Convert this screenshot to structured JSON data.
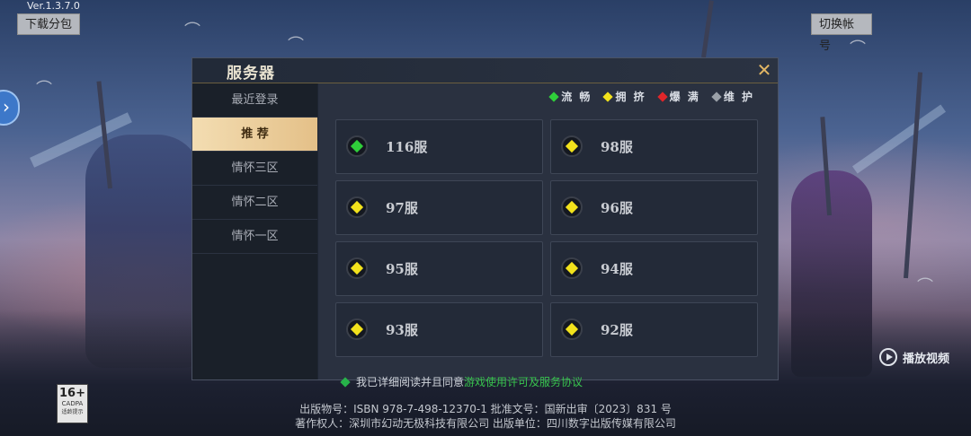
{
  "app": {
    "version": "Ver.1.3.7.0",
    "download_label": "下载分包",
    "switch_account_label": "切换帐号",
    "play_video_label": "播放视频"
  },
  "dialog": {
    "title": "服务器",
    "close_icon": "close-x-icon",
    "sidebar": [
      {
        "label": "最近登录",
        "active": false
      },
      {
        "label": "推 荐",
        "active": true
      },
      {
        "label": "情怀三区",
        "active": false
      },
      {
        "label": "情怀二区",
        "active": false
      },
      {
        "label": "情怀一区",
        "active": false
      }
    ],
    "legend": [
      {
        "label": "流 畅",
        "color": "#2fcf3a"
      },
      {
        "label": "拥 挤",
        "color": "#f2e21c"
      },
      {
        "label": "爆 满",
        "color": "#e0262a"
      },
      {
        "label": "维 护",
        "color": "#9aa0a8"
      }
    ],
    "servers": [
      {
        "name": "116服",
        "status_color": "#2fcf3a"
      },
      {
        "name": "98服",
        "status_color": "#f2e21c"
      },
      {
        "name": "97服",
        "status_color": "#f2e21c"
      },
      {
        "name": "96服",
        "status_color": "#f2e21c"
      },
      {
        "name": "95服",
        "status_color": "#f2e21c"
      },
      {
        "name": "94服",
        "status_color": "#f2e21c"
      },
      {
        "name": "93服",
        "status_color": "#f2e21c"
      },
      {
        "name": "92服",
        "status_color": "#f2e21c"
      }
    ]
  },
  "footer": {
    "agree_text": "我已详细阅读并且同意",
    "agree_link": "游戏使用许可及服务协议",
    "line1": "出版物号：ISBN 978-7-498-12370-1  批准文号：国新出审〔2023〕831 号",
    "line2": "著作权人：深圳市幻动无极科技有限公司  出版单位：四川数字出版传媒有限公司",
    "rating": {
      "age": "16+",
      "org": "CADPA",
      "tip": "适龄提示"
    }
  }
}
